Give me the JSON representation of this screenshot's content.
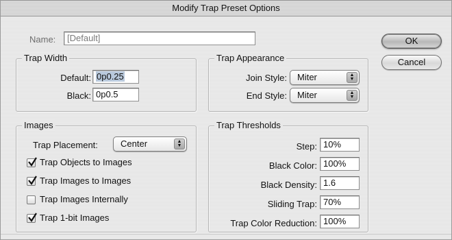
{
  "window": {
    "title": "Modify Trap Preset Options"
  },
  "name_field": {
    "label": "Name:",
    "value": "[Default]"
  },
  "buttons": {
    "ok": "OK",
    "cancel": "Cancel"
  },
  "trap_width": {
    "title": "Trap Width",
    "default_label": "Default:",
    "default_value": "0p0.25",
    "black_label": "Black:",
    "black_value": "0p0.5"
  },
  "trap_appearance": {
    "title": "Trap Appearance",
    "join_label": "Join Style:",
    "join_value": "Miter",
    "end_label": "End Style:",
    "end_value": "Miter"
  },
  "images": {
    "title": "Images",
    "placement_label": "Trap Placement:",
    "placement_value": "Center",
    "checkboxes": [
      {
        "label": "Trap Objects to Images",
        "checked": true
      },
      {
        "label": "Trap Images to Images",
        "checked": true
      },
      {
        "label": "Trap Images Internally",
        "checked": false
      },
      {
        "label": "Trap 1-bit Images",
        "checked": true
      }
    ]
  },
  "trap_thresholds": {
    "title": "Trap Thresholds",
    "rows": [
      {
        "label": "Step:",
        "value": "10%"
      },
      {
        "label": "Black Color:",
        "value": "100%"
      },
      {
        "label": "Black Density:",
        "value": "1.6"
      },
      {
        "label": "Sliding Trap:",
        "value": "70%"
      },
      {
        "label": "Trap Color Reduction:",
        "value": "100%"
      }
    ]
  }
}
